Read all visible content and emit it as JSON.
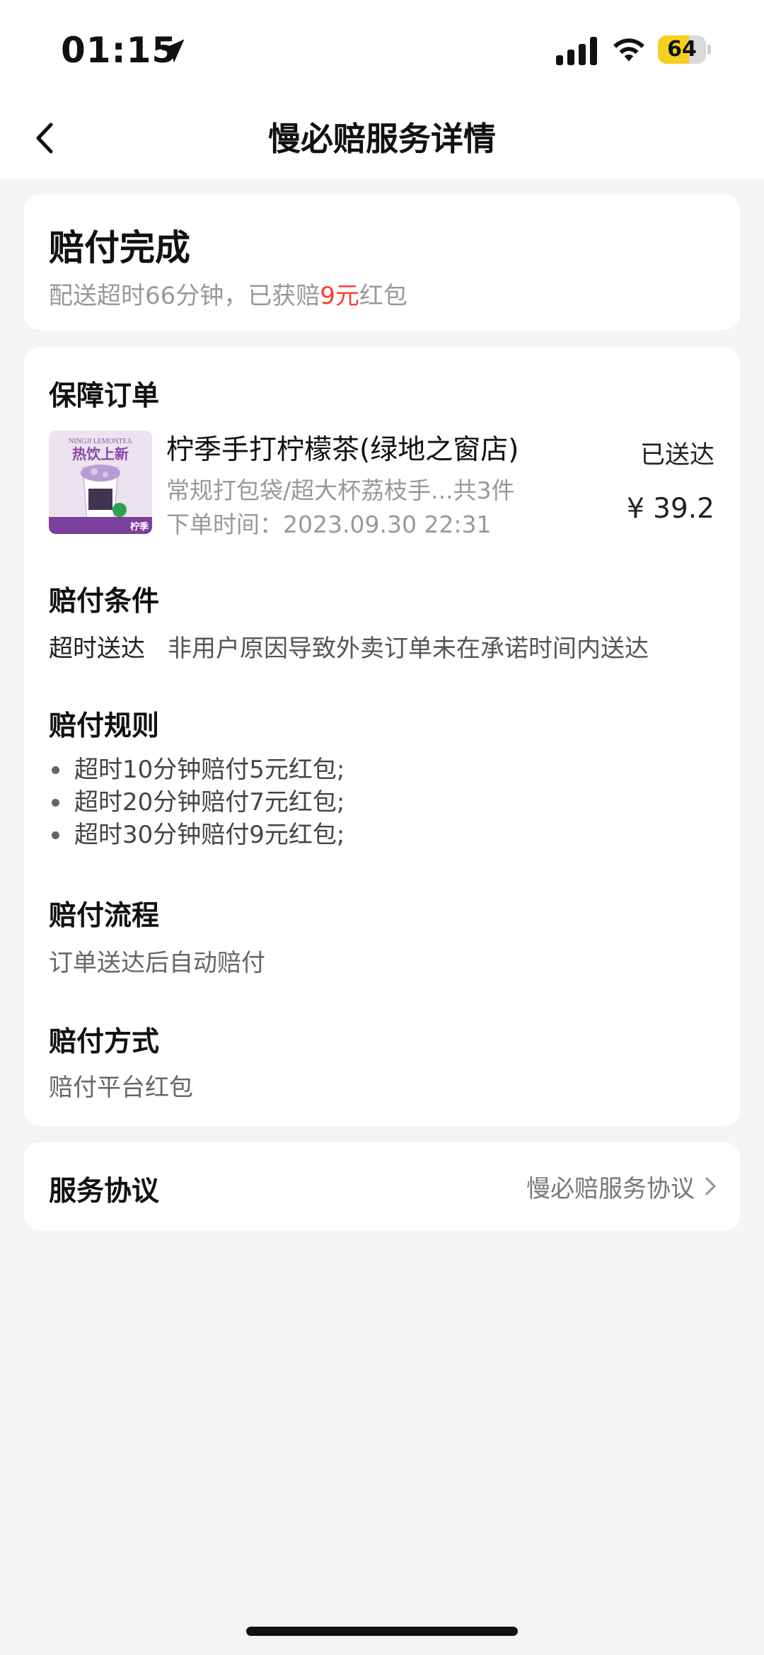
{
  "status_bar": {
    "time": "01:15",
    "battery": "64",
    "battery_level": 0.64,
    "icons": [
      "location-arrow-icon",
      "cellular-signal-icon",
      "wifi-icon",
      "battery-icon"
    ]
  },
  "nav": {
    "title": "慢必赔服务详情",
    "back_icon": "chevron-left-icon"
  },
  "status_card": {
    "title": "赔付完成",
    "desc_prefix": "配送超时66分钟，已获赔",
    "desc_amount": "9元",
    "desc_suffix": "红包",
    "amount_color": "#ff3b30"
  },
  "order": {
    "section_title": "保障订单",
    "thumbnail": {
      "brand_en": "NINGJI LEMONTEA",
      "headline": "热饮上新",
      "brand_cn": "柠季"
    },
    "shop_name": "柠季手打柠檬茶(绿地之窗店)",
    "items": "常规打包袋/超大杯荔枝手...共3件",
    "time": "下单时间：2023.09.30 22:31",
    "status": "已送达",
    "price": "¥ 39.2"
  },
  "conditions": {
    "title": "赔付条件",
    "label": "超时送达",
    "text": "非用户原因导致外卖订单未在承诺时间内送达"
  },
  "rules": {
    "title": "赔付规则",
    "items": [
      "超时10分钟赔付5元红包;",
      "超时20分钟赔付7元红包;",
      "超时30分钟赔付9元红包;"
    ]
  },
  "process": {
    "title": "赔付流程",
    "text": "订单送达后自动赔付"
  },
  "method": {
    "title": "赔付方式",
    "text": "赔付平台红包"
  },
  "agreement": {
    "title": "服务协议",
    "link": "慢必赔服务协议",
    "link_icon": "chevron-right-icon"
  }
}
